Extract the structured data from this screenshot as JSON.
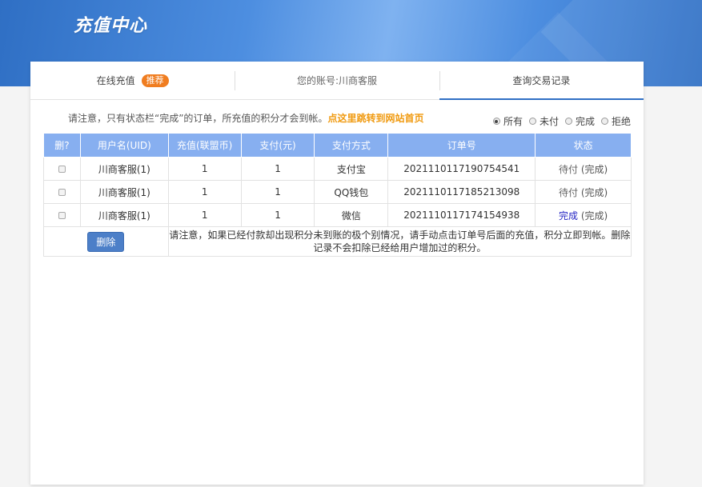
{
  "banner": {
    "title": "充值中心"
  },
  "tabs": [
    {
      "label": "在线充值",
      "badge": "推荐"
    },
    {
      "label": "您的账号:川商客服"
    },
    {
      "label": "查询交易记录"
    }
  ],
  "notice": {
    "text": "请注意，只有状态栏“完成”的订单，所充值的积分才会到帐。",
    "link": "点这里跳转到网站首页"
  },
  "filters": [
    {
      "label": "所有",
      "checked": true
    },
    {
      "label": "未付",
      "checked": false
    },
    {
      "label": "完成",
      "checked": false
    },
    {
      "label": "拒绝",
      "checked": false
    }
  ],
  "table": {
    "headers": [
      "删?",
      "用户名(UID)",
      "充值(联盟币)",
      "支付(元)",
      "支付方式",
      "订单号",
      "状态"
    ],
    "rows": [
      {
        "user": "川商客服(1)",
        "coins": "1",
        "paid": "1",
        "method": "支付宝",
        "order": "2021110117190754541",
        "status_main": "待付",
        "status_note": "(完成)"
      },
      {
        "user": "川商客服(1)",
        "coins": "1",
        "paid": "1",
        "method": "QQ钱包",
        "order": "2021110117185213098",
        "status_main": "待付",
        "status_note": "(完成)"
      },
      {
        "user": "川商客服(1)",
        "coins": "1",
        "paid": "1",
        "method": "微信",
        "order": "2021110117174154938",
        "status_main": "完成",
        "status_note": "(完成)"
      }
    ],
    "delete_label": "删除",
    "footer_note": "请注意，如果已经付款却出现积分未到账的极个别情况，请手动点击订单号后面的充值，积分立即到帐。删除记录不会扣除已经给用户增加过的积分。"
  },
  "colors": {
    "header_bg": "#87aff0",
    "accent": "#2f6fc4",
    "badge": "#f07d20",
    "link": "#f09a10",
    "done": "#2626c4"
  }
}
